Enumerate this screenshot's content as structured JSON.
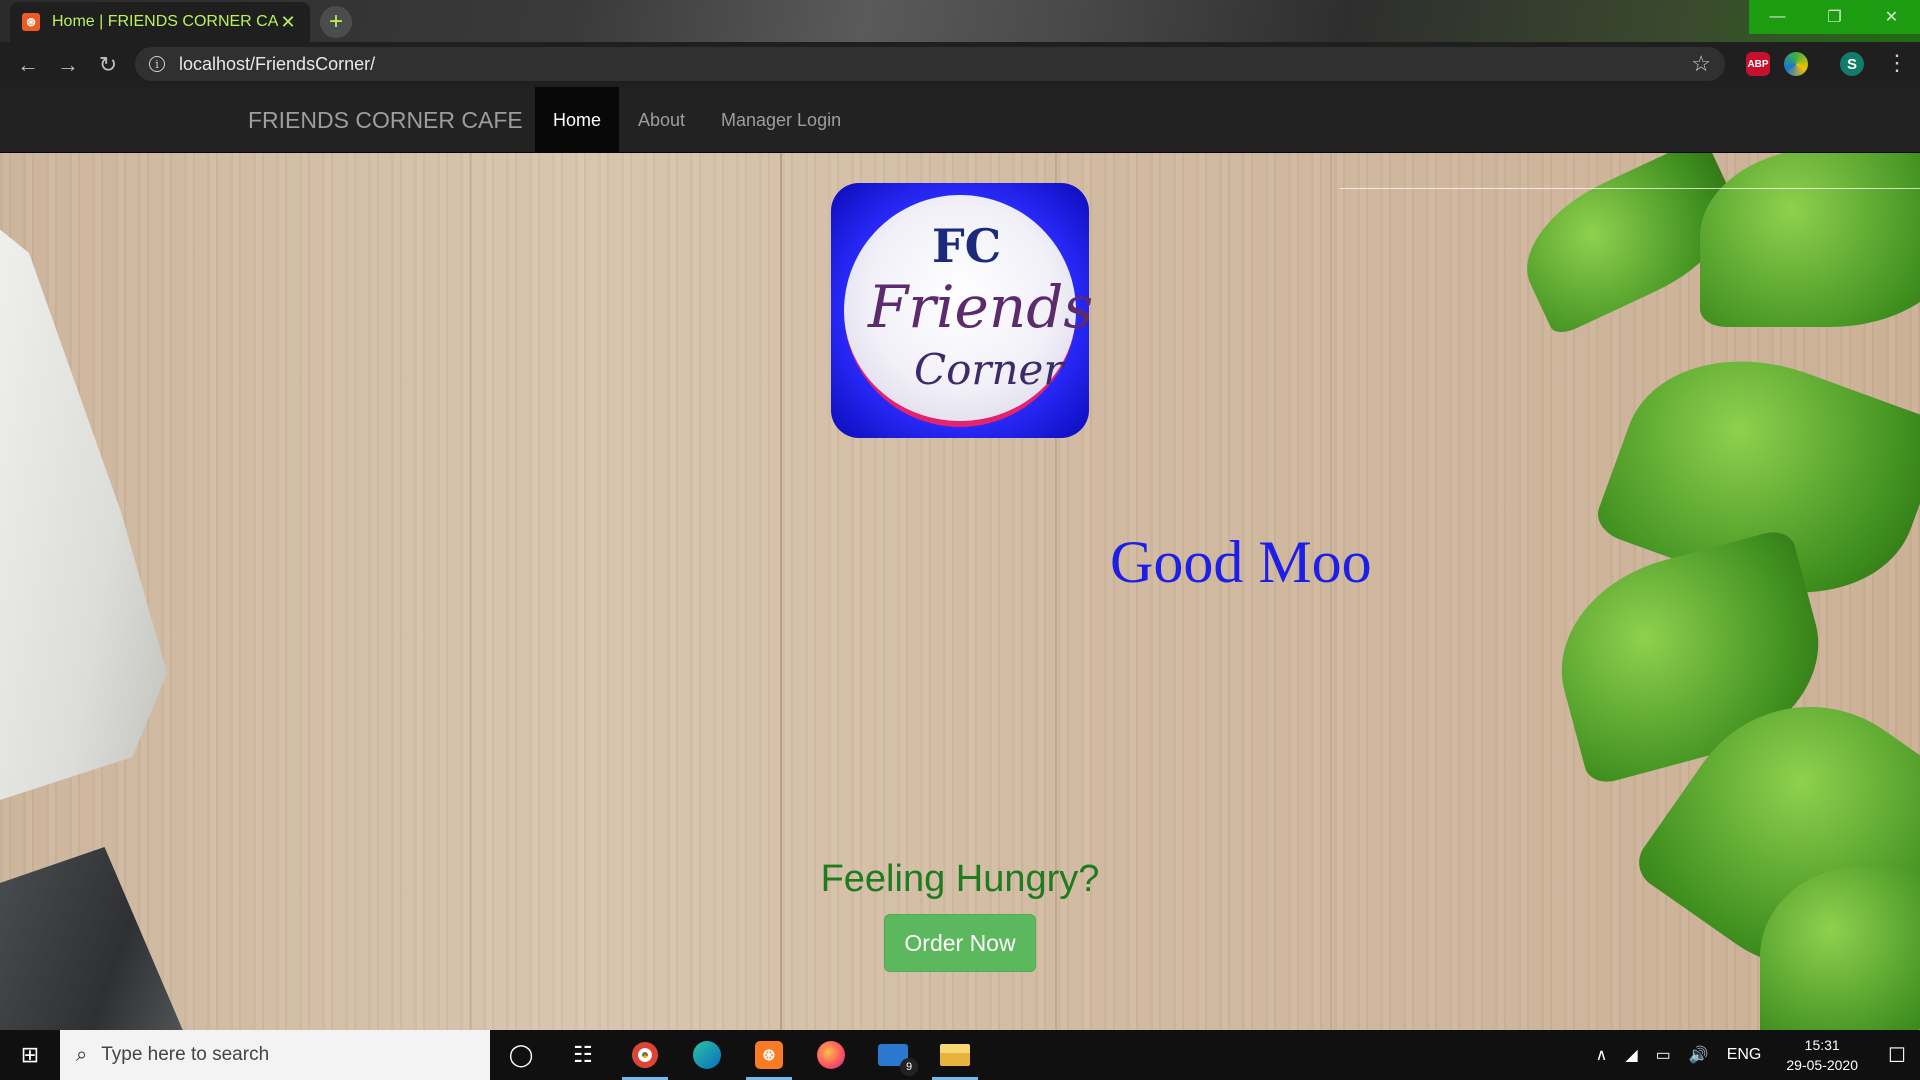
{
  "browser": {
    "tab_title": "Home | FRIENDS CORNER CAFE",
    "tab_favicon": "xampp-icon",
    "url": "localhost/FriendsCorner/",
    "accent_color": "#1d9c12"
  },
  "navbar": {
    "brand": "FRIENDS CORNER CAFE",
    "links": [
      "Home",
      "About",
      "Manager Login"
    ],
    "active": "Home"
  },
  "hero": {
    "logo_alt": "Friends Corner logo",
    "marquee_text": "Good Moo",
    "cta_heading": "Feeling Hungry?",
    "cta_button": "Order Now",
    "colors": {
      "marquee": "#1d1ee6",
      "heading": "#1e7b1e",
      "button": "#5cb85c"
    }
  },
  "taskbar": {
    "search_placeholder": "Type here to search",
    "apps": [
      "cortana-icon",
      "task-view-icon",
      "chrome-icon",
      "edge-icon",
      "xampp-icon",
      "firefox-icon",
      "mail-icon",
      "file-explorer-icon"
    ],
    "mail_badge": "9",
    "language": "ENG",
    "time": "15:31",
    "date": "29-05-2020"
  }
}
